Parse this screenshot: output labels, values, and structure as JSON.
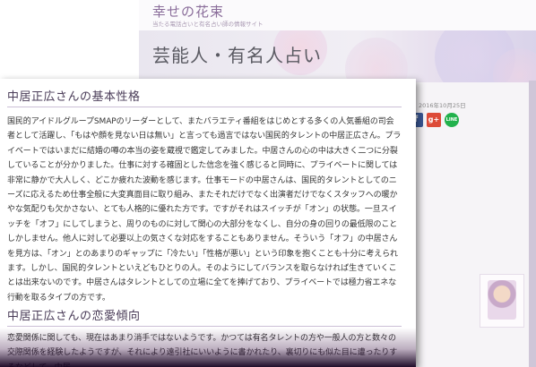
{
  "site": {
    "title": "幸せの花束",
    "tagline": "当たる電話占いと有名占い師の情報サイト"
  },
  "page": {
    "category_title": "芸能人・有名人占い",
    "date": "2016年10月25日"
  },
  "share": [
    {
      "icon": "facebook-icon",
      "label": "f",
      "color": "#3b5998"
    },
    {
      "icon": "google-plus-icon",
      "label": "g+",
      "color": "#dd4b39"
    },
    {
      "icon": "line-icon",
      "label": "LINE",
      "color": "#22b14c"
    }
  ],
  "article": {
    "section1_heading": "中居正広さんの基本性格",
    "section1_body": "国民的アイドルグループSMAPのリーダーとして、またバラエティ番組をはじめとする多くの人気番組の司会者として活躍し、「もはや顔を見ない日は無い」と言っても過言ではない国民的タレントの中居正広さん。プライベートではいまだに結婚の噂の本当の姿を蔵視で鑑定してみました。中居さんの心の中は大きく二つに分裂していることが分かりました。仕事に対する確固とした信念を強く感じると同時に、プライベートに関しては非常に静かで大人しく、どこか疲れた波動を感じます。仕事モードの中居さんは、国民的タレントとしてのニーズに応えるため仕事全般に大変真面目に取り組み、またそれだけでなく出演者だけでなくスタッフへの暖かやな気配りも欠かさない、とても人格的に優れた方です。ですがそれはスイッチが「オン」の状態。一旦スイッチを「オフ」にしてしまうと、周りのものに対して関心の大部分をなくし、自分の身の回りの最低限のことしかしません。他人に対して必要以上の気さくな対応をすることもありません。そういう「オフ」の中居さんを見方は、「オン」とのあまりのギャップに「冷たい」「性格が悪い」という印象を抱くことも十分に考えられます。しかし、国民的タレントといえどもひとりの人。そのようにしてバランスを取らなければ生きていくことは出来ないのです。中居さんはタレントとしての立場に全てを捧げており、プライベートでは極力省エネな行動を取るタイプの方です。",
    "section2_heading": "中居正広さんの恋愛傾向",
    "section2_body": "恋愛関係に関しても、現在はあまり消手ではないようです。かつては有名タレントの方や一般人の方と数々の交際関係を経験したようですが、それにより遠引社にいいように書かれたり、裏切りにも似た目に遭ったりするなどして、中居"
  },
  "colors": {
    "accent": "#8a6d9a",
    "heading_rule": "#cbbfd6"
  }
}
